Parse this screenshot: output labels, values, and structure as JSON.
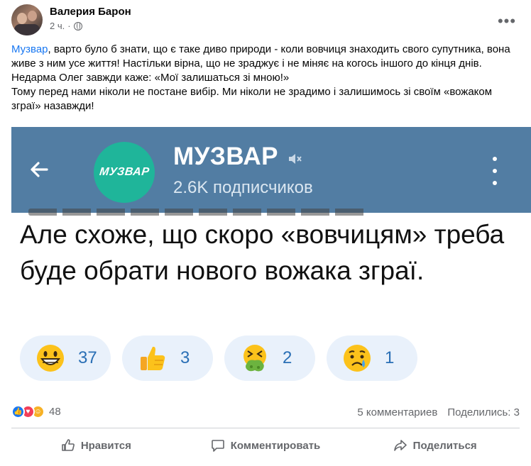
{
  "author": {
    "name": "Валерия Барон",
    "time": "2 ч.",
    "privacy_icon": "globe-icon"
  },
  "post": {
    "link": "Музвар",
    "text": ", варто було б знати, що є таке диво природи - коли вовчиця знаходить свого супутника, вона живе з ним усе життя! Настільки вірна, що не зраджує і не міняє на когось іншого до кінця днів. Недарма Олег завжди каже: «Мої залишаться зі мною!»",
    "text2": "Тому перед нами ніколи не постане вибір. Ми ніколи не зрадимо і залишимось зі своїм «вожаком зграї» назавжди!"
  },
  "screenshot": {
    "channel_name": "МУЗВАР",
    "subscribers": "2.6K подписчиков",
    "logo_text": "МУЗВАР",
    "message": "Але схоже, що скоро «вовчицям» треба буде обрати нового вожака зграї.",
    "reactions": [
      {
        "icon": "grinning-face-icon",
        "count": "37"
      },
      {
        "icon": "thumbs-up-icon",
        "count": "3"
      },
      {
        "icon": "vomiting-face-icon",
        "count": "2"
      },
      {
        "icon": "crying-face-icon",
        "count": "1"
      }
    ],
    "bar_color": "#527da3",
    "logo_color": "#1fb59a"
  },
  "stats": {
    "reactions": "48",
    "comments": "5 комментариев",
    "shares": "Поделились: 3"
  },
  "actions": {
    "like": "Нравится",
    "comment": "Комментировать",
    "share": "Поделиться"
  }
}
